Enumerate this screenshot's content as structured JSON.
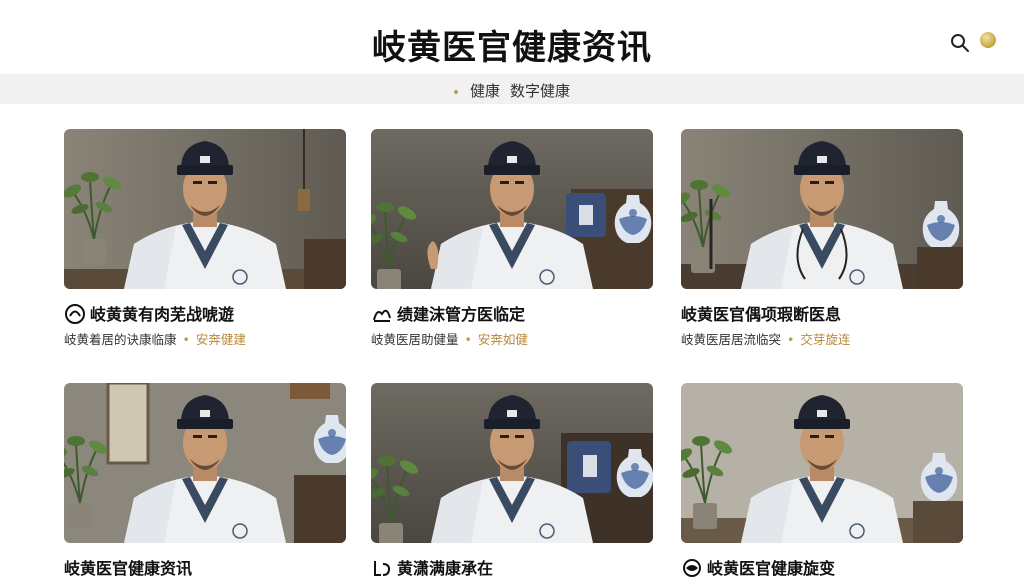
{
  "header": {
    "title": "岐黄医官健康资讯"
  },
  "nav": {
    "crumbs": [
      "健康",
      "数字健康"
    ]
  },
  "cards": [
    {
      "title": "岐黄黄有肉芜战唬遊",
      "meta_left": "岐黄着居的诀康临康",
      "meta_tag": "安奔健建",
      "has_logo": true
    },
    {
      "title": "绩建沫管方医临定",
      "meta_left": "岐黄医居助健量",
      "meta_tag": "安奔如健",
      "has_logo": true
    },
    {
      "title": "岐黄医官偶项瑕断医息",
      "meta_left": "岐黄医居居流临突",
      "meta_tag": "交芽旋连",
      "has_logo": false
    },
    {
      "title": "岐黄医官健康资讯",
      "meta_left": "",
      "meta_tag": "",
      "has_logo": false
    },
    {
      "title": "黄潇满康承在",
      "meta_left": "",
      "meta_tag": "",
      "has_logo": true
    },
    {
      "title": "岐黄医官健康旋变",
      "meta_left": "",
      "meta_tag": "",
      "has_logo": true
    }
  ],
  "colors": {
    "accent": "#c09a4a",
    "subbar": "#f1f1f1"
  }
}
